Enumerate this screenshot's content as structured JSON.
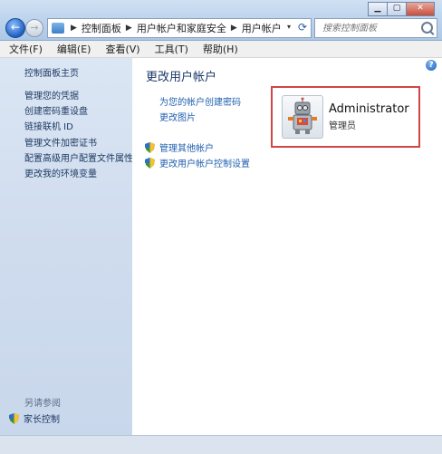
{
  "window": {
    "controls": {
      "minimize": "▁",
      "maximize": "▢",
      "close": "✕"
    }
  },
  "nav": {
    "back_glyph": "←",
    "forward_glyph": "→",
    "breadcrumbs": [
      "控制面板",
      "用户帐户和家庭安全",
      "用户帐户"
    ],
    "separator": "▶",
    "dropdown_glyph": "▾",
    "refresh_glyph": "⟳"
  },
  "search": {
    "placeholder": "搜索控制面板"
  },
  "menu": {
    "items": [
      "文件(F)",
      "编辑(E)",
      "查看(V)",
      "工具(T)",
      "帮助(H)"
    ]
  },
  "sidebar": {
    "home": "控制面板主页",
    "links": [
      "管理您的凭据",
      "创建密码重设盘",
      "链接联机 ID",
      "管理文件加密证书",
      "配置高级用户配置文件属性",
      "更改我的环境变量"
    ],
    "see_also": "另请参阅",
    "parental": "家长控制"
  },
  "content": {
    "help_glyph": "?",
    "heading": "更改用户帐户",
    "links": [
      "为您的帐户创建密码",
      "更改图片"
    ],
    "tasks": [
      "管理其他帐户",
      "更改用户帐户控制设置"
    ]
  },
  "user": {
    "name": "Administrator",
    "role": "管理员"
  },
  "colors": {
    "accent": "#1f5fae",
    "highlight_border": "#d24545"
  }
}
